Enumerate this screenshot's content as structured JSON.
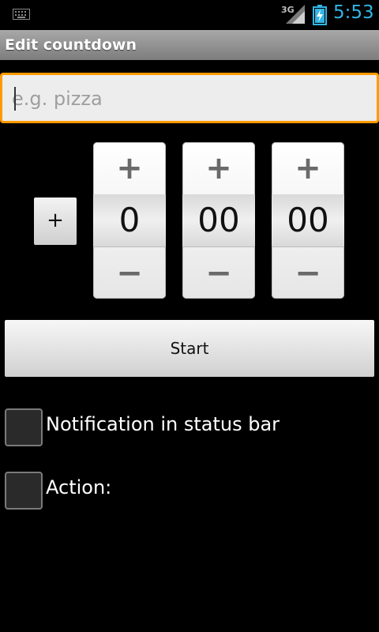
{
  "status_bar": {
    "network": "3G",
    "time": "5:53",
    "icons": [
      "keyboard-icon",
      "signal-icon",
      "battery-charging-icon"
    ]
  },
  "title_bar": {
    "title": "Edit countdown"
  },
  "name_input": {
    "placeholder": "e.g. pizza",
    "value": ""
  },
  "small_plus": {
    "label": "+"
  },
  "time_picker": {
    "hours": "0",
    "minutes": "00",
    "seconds": "00",
    "increment_glyph": "+",
    "decrement_glyph": "−"
  },
  "start_button": {
    "label": "Start"
  },
  "checkboxes": [
    {
      "label": "Notification in status bar",
      "checked": false
    },
    {
      "label": "Action:",
      "checked": false
    }
  ],
  "colors": {
    "accent_clock": "#33b5e5",
    "focus_border": "#ff9a00",
    "title_bar": "#8f8f8f"
  }
}
